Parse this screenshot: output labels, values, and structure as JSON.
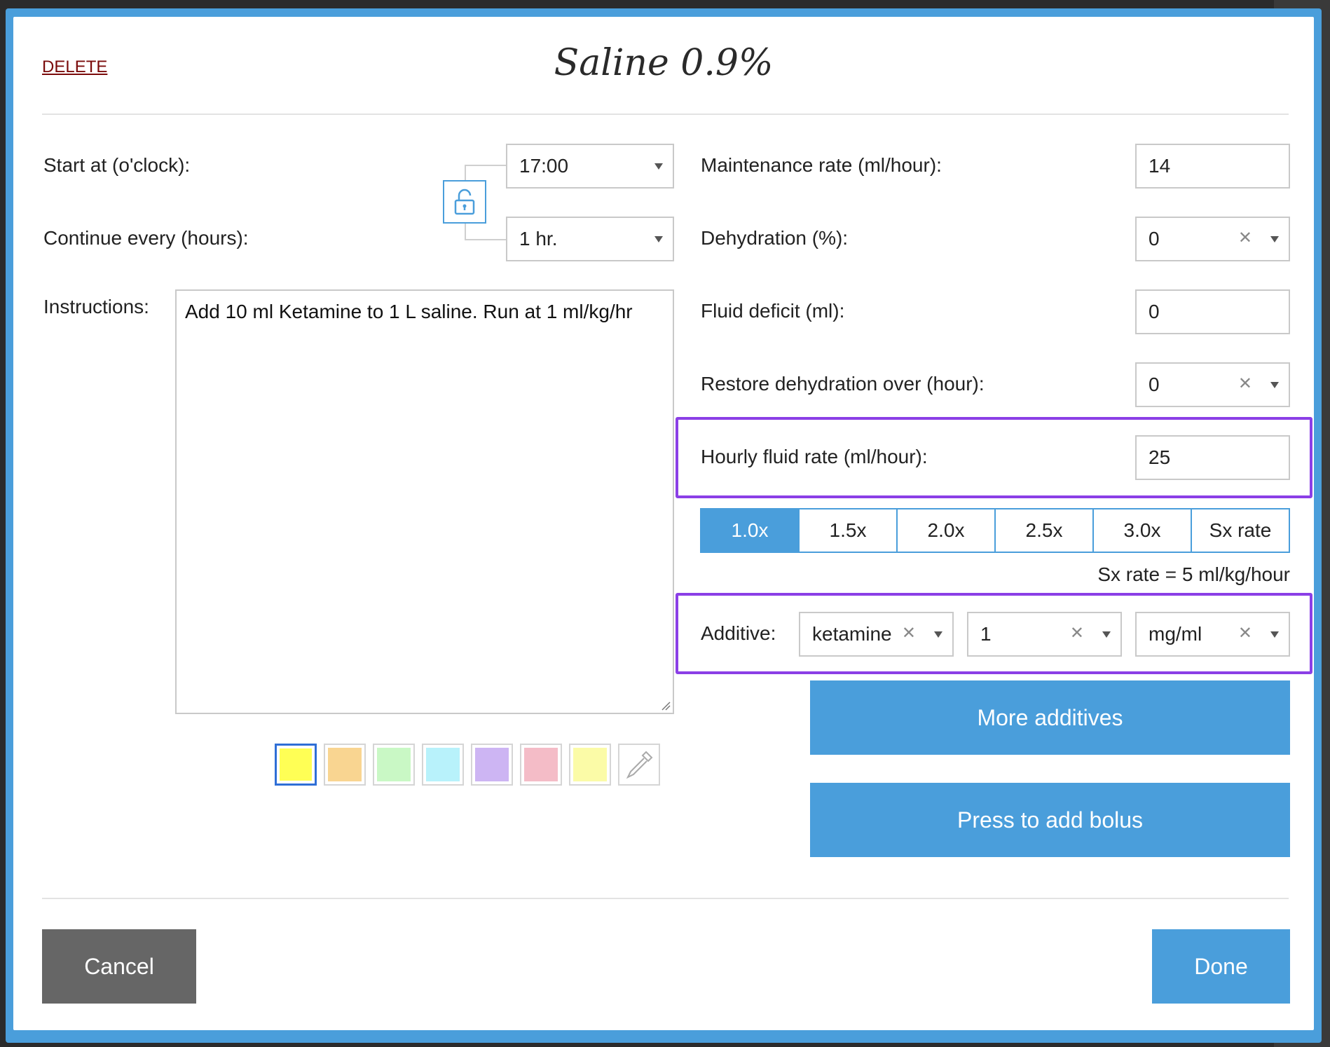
{
  "dialog": {
    "title": "Saline 0.9%",
    "delete_label": "DELETE"
  },
  "left": {
    "start_label": "Start at (o'clock):",
    "start_value": "17:00",
    "continue_label": "Continue every (hours):",
    "continue_value": "1 hr.",
    "instructions_label": "Instructions:",
    "instructions_text": "Add 10 ml Ketamine to 1 L saline. Run at 1 ml/kg/hr",
    "swatches": [
      {
        "color": "#ffff55",
        "selected": true
      },
      {
        "color": "#f9d591"
      },
      {
        "color": "#c9f8c5"
      },
      {
        "color": "#b8f2fb"
      },
      {
        "color": "#cdb5f3"
      },
      {
        "color": "#f4bcc7"
      },
      {
        "color": "#fbfba7"
      },
      {
        "icon": "eyedropper-icon"
      }
    ]
  },
  "right": {
    "maintenance_label": "Maintenance rate (ml/hour):",
    "maintenance_value": "14",
    "dehydration_label": "Dehydration (%):",
    "dehydration_value": "0",
    "deficit_label": "Fluid deficit (ml):",
    "deficit_value": "0",
    "restore_label": "Restore dehydration over (hour):",
    "restore_value": "0",
    "hourly_label": "Hourly fluid rate (ml/hour):",
    "hourly_value": "25",
    "multipliers": [
      "1.0x",
      "1.5x",
      "2.0x",
      "2.5x",
      "3.0x",
      "Sx rate"
    ],
    "active_multiplier": "1.0x",
    "sx_note": "Sx rate = 5 ml/kg/hour",
    "additive_label": "Additive:",
    "additive_name": "ketamine",
    "additive_amount": "1",
    "additive_unit": "mg/ml",
    "more_additives_label": "More additives",
    "bolus_label": "Press to add bolus"
  },
  "footer": {
    "cancel_label": "Cancel",
    "done_label": "Done"
  },
  "colors": {
    "accent": "#4a9edb",
    "highlight": "#8b3fe6",
    "cancel_bg": "#666666",
    "delete_text": "#7a0a0a"
  }
}
